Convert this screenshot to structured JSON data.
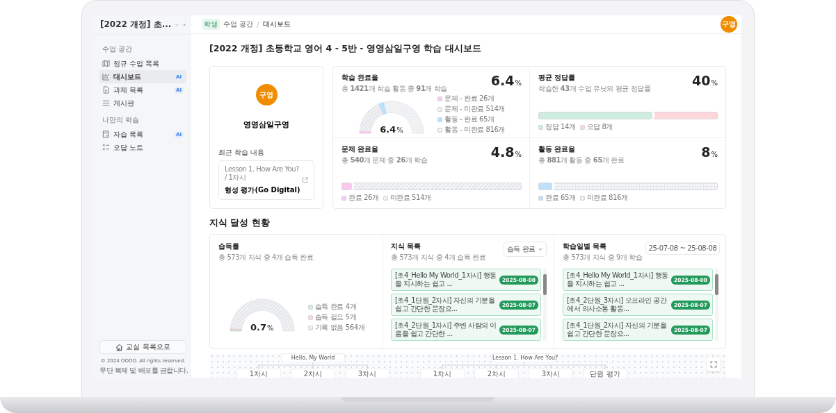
{
  "sidebar": {
    "title": "[2022 개정] 초...",
    "sections": [
      {
        "heading": "수업 공간",
        "items": [
          {
            "label": "정규 수업 목록",
            "kind": "map",
            "selected": false
          },
          {
            "label": "대시보드",
            "kind": "chart",
            "selected": true,
            "badge": "AI"
          },
          {
            "label": "과제 목록",
            "kind": "doc",
            "selected": false,
            "badge": "AI"
          },
          {
            "label": "게시판",
            "kind": "list",
            "selected": false
          }
        ]
      },
      {
        "heading": "나만의 학습",
        "items": [
          {
            "label": "자습 목록",
            "kind": "book",
            "selected": false,
            "badge": "AI"
          },
          {
            "label": "오답 노트",
            "kind": "checks",
            "selected": false
          }
        ]
      }
    ],
    "home_button": "교실 목록으로",
    "copyright": "© 2024 OOOO. All rights reserved.",
    "notice": "무단 복제 및 배포를 금합니다."
  },
  "topbar": {
    "role_badge": "학생",
    "breadcrumb": [
      "수업 공간",
      "대시보드"
    ],
    "separator": "/",
    "avatar": "구영"
  },
  "page_title": "[2022 개정] 초등학교 영어 4 - 5반 - 영영삼일구영 학습 대시보드",
  "profile": {
    "avatar": "구영",
    "name": "영영삼일구영",
    "recent_label": "최근 학습 내용",
    "recent_path": "Lesson 1. How Are You? / 1차시",
    "recent_title": "형성 평가(Go Digital)"
  },
  "stats": [
    {
      "kind": "gauge",
      "title": "학습 완료율",
      "subtitle": "총 **1421**개 학습 활동 중 **91**개 학습",
      "value": "6.4",
      "unit": "%",
      "center_value": "6.4",
      "center_unit": "%",
      "legend": [
        {
          "label": "문제 - 완료 26개",
          "color": "#f9c9ec",
          "kind": "solid"
        },
        {
          "label": "문제 - 미완료 514개",
          "color": "#e4e6ea",
          "kind": "hatch"
        },
        {
          "label": "활동 - 완료 65개",
          "color": "#bfe0fb",
          "kind": "solid"
        },
        {
          "label": "활동 - 미완료 816개",
          "color": "#e4e6ea",
          "kind": "grid"
        }
      ]
    },
    {
      "kind": "bar",
      "title": "평균 정답률",
      "subtitle": "학습한 **43**개 수업 유닛의 평균 정답률",
      "value": "40",
      "unit": "%",
      "level": 0.64,
      "segments": [
        {
          "label": "정답 14개",
          "color": "#cdeedd",
          "kind": "solid"
        },
        {
          "label": "오답 8개",
          "color": "#ffd6da",
          "kind": "solid"
        }
      ]
    },
    {
      "kind": "bar",
      "title": "문제 완료율",
      "subtitle": "총 **540**개 문제 중 **26**개 학습",
      "value": "4.8",
      "unit": "%",
      "level": 0.06,
      "segments": [
        {
          "label": "완료 26개",
          "color": "#f9c9ec",
          "kind": "solid"
        },
        {
          "label": "미완료 514개",
          "color": "#e4e6ea",
          "kind": "hatch"
        }
      ]
    },
    {
      "kind": "bar",
      "title": "활동 완료율",
      "subtitle": "총 **881**개 활동 중 **65**개 완료",
      "value": "8",
      "unit": "%",
      "level": 0.08,
      "segments": [
        {
          "label": "완료 65개",
          "color": "#bfe0fb",
          "kind": "solid"
        },
        {
          "label": "미완료 816개",
          "color": "#e4e6ea",
          "kind": "grid"
        }
      ]
    }
  ],
  "knowledge": {
    "heading": "지식 달성 현황",
    "acquisition": {
      "title": "습득률",
      "subtitle": "총 573개 지식 중 4개 습득 완료",
      "center_value": "0.7",
      "center_unit": "%",
      "legend": [
        {
          "label": "습득 완료 4개",
          "color": "#cdeedd",
          "kind": "solid"
        },
        {
          "label": "습득 필요 5개",
          "color": "#ffd6da",
          "kind": "solid"
        },
        {
          "label": "기록 없음 564개",
          "color": "#e4e6ea",
          "kind": "hatch"
        }
      ]
    },
    "list": {
      "title": "지식 목록",
      "subtitle": "총 573개 지식 중 4개 습득 완료",
      "filter": "습득 완료",
      "items": [
        {
          "text": "[초4_Hello My World_1차시] 행동을 지시하는 쉽고 ...",
          "date": "2025-08-08"
        },
        {
          "text": "[초4_1단원_2차시] 자신의 기분을 쉽고 간단한 문장으...",
          "date": "2025-08-07"
        },
        {
          "text": "[초4_2단원_1차시] 주변 사람의 이름을 쉽고 간단한 ...",
          "date": "2025-08-07"
        }
      ]
    },
    "by_date": {
      "title": "학습일별 목록",
      "subtitle": "총 573개 지식 중 9개 학습",
      "date_range": "25-07-08 ~ 25-08-08",
      "items": [
        {
          "text": "[초4_Hello My World_1차시] 행동을 지시하는 쉽고 ...",
          "date": "2025-08-08"
        },
        {
          "text": "[초4_2단원_3차시] 오프라인 공간에서 의사소통 활동...",
          "date": "2025-08-07"
        },
        {
          "text": "[초4_1단원_2차시] 자신의 기분을 쉽고 간단한 문장으...",
          "date": "2025-08-07"
        }
      ]
    }
  },
  "tree": [
    {
      "label": "Hello, My World",
      "children": [
        {
          "label": "1차시"
        },
        {
          "label": "2차시"
        },
        {
          "label": "3차시"
        }
      ]
    },
    {
      "label": "Lesson 1. How Are You?",
      "children": [
        {
          "label": "1차시"
        },
        {
          "label": "2차시"
        },
        {
          "label": "3차시"
        },
        {
          "label": "단원 평가"
        }
      ]
    }
  ]
}
